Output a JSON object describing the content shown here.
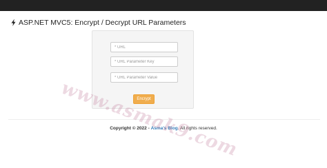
{
  "header": {
    "title": "ASP.NET MVC5: Encrypt / Decrypt URL Parameters",
    "icon": "bolt-icon"
  },
  "form": {
    "url_placeholder": "* URL",
    "key_placeholder": "* URL Parameter Key",
    "value_placeholder": "* URL Parameter Value",
    "encrypt_label": "Encrypt"
  },
  "footer": {
    "copyright": "Copyright © 2022 -",
    "link_text": "Asma's Blog",
    "suffix": ". All rights reserved."
  },
  "watermark": {
    "text": "www.asmak9.com"
  },
  "colors": {
    "topbar": "#222222",
    "button": "#f0ad4e",
    "link": "#337ab7"
  }
}
